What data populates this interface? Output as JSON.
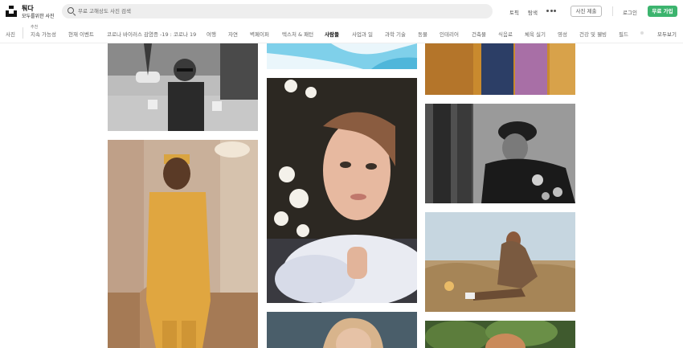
{
  "brand": {
    "name": "퉈다",
    "tagline": "모두를위한 사진"
  },
  "search": {
    "placeholder": "무료 고해상도 사진 검색",
    "value": ""
  },
  "nav": {
    "links": [
      "토픽",
      "탐색"
    ],
    "more_icon": "more-horizontal-icon",
    "submit_label": "사진 제출",
    "login_label": "로그인",
    "join_label": "무료 가입"
  },
  "topics": {
    "first": "사진",
    "featured_label": "추천",
    "items": [
      "지속 가능성",
      "현재 이벤트",
      "코로나 바이러스 감염증 -19 : 코로나 19",
      "여행",
      "자연",
      "벽페이퍼",
      "텍스처 & 패턴",
      "사람들",
      "사업과 일",
      "과학 기술",
      "동물",
      "인테리어",
      "건축물",
      "식음료",
      "체육 실기",
      "영성",
      "건강 및 웰빙",
      "필드"
    ],
    "active": "사람들",
    "view_all": "모두보기"
  },
  "colors": {
    "accent": "#3cb46e",
    "background": "#ffffff"
  },
  "gallery": {
    "columns": [
      [
        "photo-street-man-bw",
        "photo-man-mustard-suit"
      ],
      [
        "photo-blue-fabric",
        "photo-woman-flowers",
        "photo-woman-blonde"
      ],
      [
        "photo-mustard-clothes",
        "photo-elder-woman-bw",
        "photo-woman-field",
        "photo-greenery"
      ]
    ]
  }
}
